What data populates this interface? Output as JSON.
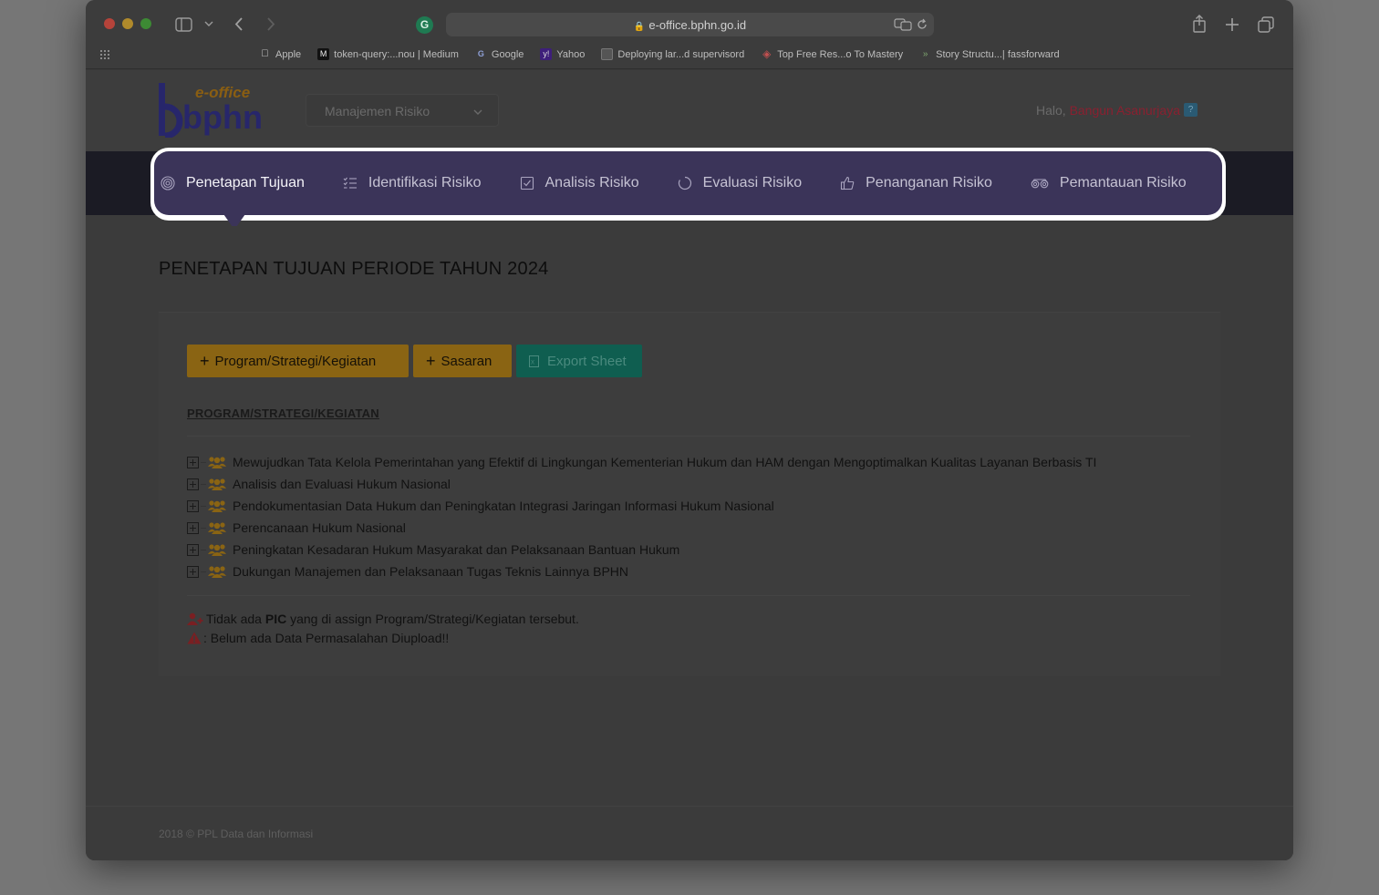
{
  "browser": {
    "url": "e-office.bphn.go.id",
    "bookmarks": [
      {
        "label": "Apple",
        "icon": "apple-icon"
      },
      {
        "label": "token-query:...nou | Medium",
        "icon": "medium-icon"
      },
      {
        "label": "Google",
        "icon": "google-icon"
      },
      {
        "label": "Yahoo",
        "icon": "yahoo-icon"
      },
      {
        "label": "Deploying lar...d supervisord",
        "icon": "page-icon"
      },
      {
        "label": "Top Free Res...o To Mastery",
        "icon": "ztm-icon"
      },
      {
        "label": "Story Structu...| fassforward",
        "icon": "ff-icon"
      }
    ]
  },
  "header": {
    "logo_top": "e-office",
    "logo_main": "bphn",
    "module_select": "Manajemen Risiko",
    "greeting": "Halo,",
    "user_name": "Bangun Asanurjaya",
    "help": "?"
  },
  "nav": {
    "items": [
      {
        "label": "Penetapan Tujuan",
        "icon": "target-icon",
        "active": true
      },
      {
        "label": "Identifikasi Risiko",
        "icon": "list-icon",
        "active": false
      },
      {
        "label": "Analisis Risiko",
        "icon": "checkbox-icon",
        "active": false
      },
      {
        "label": "Evaluasi Risiko",
        "icon": "circle-icon",
        "active": false
      },
      {
        "label": "Penanganan Risiko",
        "icon": "thumbs-up-icon",
        "active": false
      },
      {
        "label": "Pemantauan Risiko",
        "icon": "binoculars-icon",
        "active": false
      }
    ]
  },
  "main": {
    "title": "PENETAPAN TUJUAN PERIODE TAHUN 2024",
    "buttons": {
      "program": "Program/Strategi/Kegiatan",
      "sasaran": "Sasaran",
      "export": "Export Sheet"
    },
    "section_label": "PROGRAM/STRATEGI/KEGIATAN",
    "tree": [
      "Mewujudkan Tata Kelola Pemerintahan yang Efektif di Lingkungan Kementerian Hukum dan HAM dengan Mengoptimalkan Kualitas Layanan Berbasis TI",
      "Analisis dan Evaluasi Hukum Nasional",
      "Pendokumentasian Data Hukum dan Peningkatan Integrasi Jaringan Informasi Hukum Nasional",
      "Perencanaan Hukum Nasional",
      "Peningkatan Kesadaran Hukum Masyarakat dan Pelaksanaan Bantuan Hukum",
      "Dukungan Manajemen dan Pelaksanaan Tugas Teknis Lainnya BPHN"
    ],
    "notes": {
      "pic_prefix": "Tidak ada",
      "pic_bold": "PIC",
      "pic_suffix": "yang di assign Program/Strategi/Kegiatan tersebut.",
      "upload": ": Belum ada Data Permasalahan Diupload!!"
    }
  },
  "footer": {
    "text": "2018 © PPL Data dan Informasi"
  },
  "colors": {
    "nav_active_bg": "#3b3459",
    "button_yellow": "#8a6413",
    "button_green": "#0f5e50",
    "user_name": "#8a2030"
  }
}
